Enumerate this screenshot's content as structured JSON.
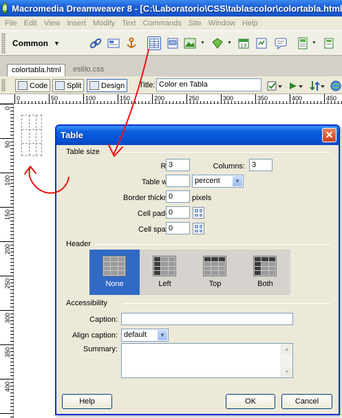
{
  "window": {
    "title": "Macromedia Dreamweaver 8 - [C:\\Laboratorio\\CSS\\tablascolor\\colortabla.html]",
    "app_icon_letter": "d"
  },
  "menu": [
    "File",
    "Edit",
    "View",
    "Insert",
    "Modify",
    "Text",
    "Commands",
    "Site",
    "Window",
    "Help"
  ],
  "insert_bar": {
    "category": "Common",
    "icons": [
      "hyperlink-icon",
      "email-link-icon",
      "named-anchor-icon",
      "table-icon",
      "layer-icon",
      "images-icon",
      "media-icon",
      "date-icon",
      "comment-icon",
      "templates-icon",
      "tag-chooser-icon"
    ]
  },
  "doc_tabs": [
    "colortabla.html",
    "estilo.css"
  ],
  "doc_toolbar": {
    "code": "Code",
    "split": "Split",
    "design": "Design",
    "title_label": "Title:",
    "title_value": "Color en Tabla"
  },
  "ruler": {
    "top": [
      "0",
      "50",
      "100",
      "150",
      "200",
      "250",
      "300",
      "350",
      "400",
      "450"
    ],
    "left": [
      "0",
      "50",
      "100",
      "150",
      "200",
      "250",
      "300",
      "350",
      "400"
    ]
  },
  "dialog": {
    "title": "Table",
    "table_size": {
      "label": "Table size",
      "rows_label": "Rows:",
      "rows_value": "3",
      "columns_label": "Columns:",
      "columns_value": "3",
      "width_label": "Table width:",
      "width_value": "",
      "width_unit": "percent",
      "border_label": "Border thickness:",
      "border_value": "0",
      "border_unit": "pixels",
      "padding_label": "Cell padding:",
      "padding_value": "0",
      "spacing_label": "Cell spacing:",
      "spacing_value": "0"
    },
    "header": {
      "label": "Header",
      "options": [
        "None",
        "Left",
        "Top",
        "Both"
      ],
      "selected": "None"
    },
    "accessibility": {
      "label": "Accessibility",
      "caption_label": "Caption:",
      "caption_value": "",
      "align_label": "Align caption:",
      "align_value": "default",
      "summary_label": "Summary:",
      "summary_value": ""
    },
    "buttons": {
      "help": "Help",
      "ok": "OK",
      "cancel": "Cancel"
    }
  },
  "colors": {
    "annotation": "#ee1111",
    "selection": "#316ac5",
    "titlebar": "#0552d6"
  }
}
